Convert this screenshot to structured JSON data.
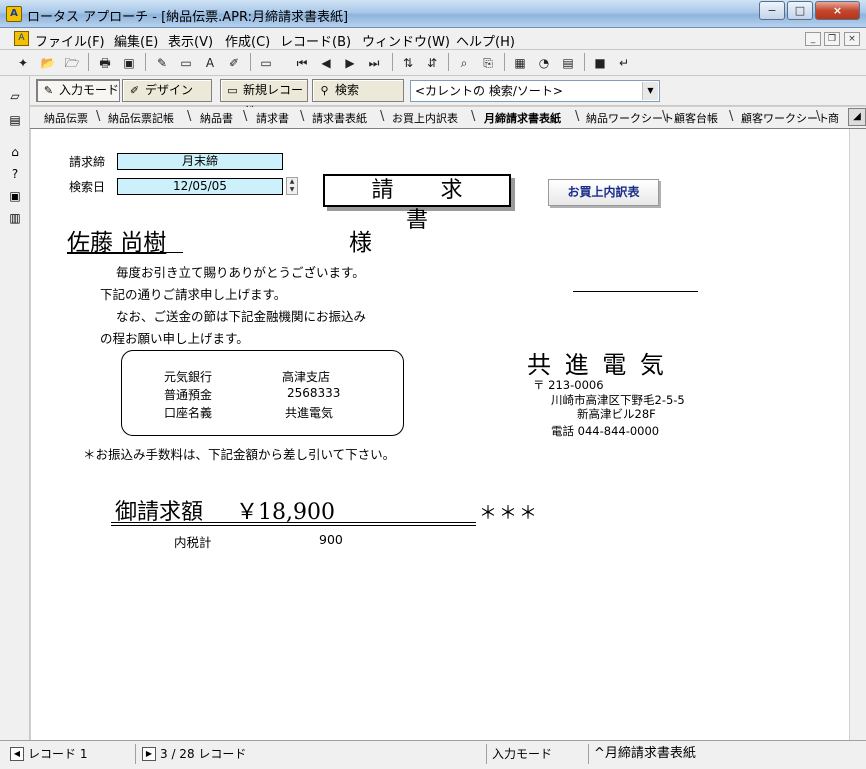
{
  "window": {
    "title": "ロータス アプローチ - [納品伝票.APR:月締請求書表紙]",
    "minimize": "−",
    "maximize": "□",
    "close": "×"
  },
  "menu": [
    "ファイル(F)",
    "編集(E)",
    "表示(V)",
    "作成(C)",
    "レコード(B)",
    "ウィンドウ(W)",
    "ヘルプ(H)"
  ],
  "toolbar2": {
    "input_mode": "入力モード",
    "design": "デザイン",
    "new_record": "新規レコード",
    "search": "検索",
    "search_select": "<カレントの 検索/ソート>"
  },
  "tabs": [
    "納品伝票",
    "納品伝票記帳",
    "納品書",
    "請求書",
    "請求書表紙",
    "お買上内訳表",
    "月締請求書表紙",
    "納品ワークシート",
    "顧客台帳",
    "顧客ワークシート",
    "商"
  ],
  "active_tab": 6,
  "form": {
    "closing_label": "請求締",
    "closing_value": "月末締",
    "search_date_label": "検索日",
    "search_date_value": "12/05/05",
    "doc_title": "請 求 書",
    "breakdown_button": "お買上内訳表",
    "customer_name": "佐藤 尚樹",
    "honorific": "様",
    "greeting": [
      "毎度お引き立て賜りありがとうございます。",
      "下記の通りご請求申し上げます。",
      "なお、ご送金の節は下記金融機関にお振込み",
      "の程お願い申し上げます。"
    ],
    "bank": {
      "bank_name": "元気銀行",
      "branch": "高津支店",
      "account_type": "普通預金",
      "account_no": "2568333",
      "holder_label": "口座名義",
      "holder": "共進電気"
    },
    "fee_note": "＊お振込み手数料は、下記金額から差し引いて下さい。",
    "company": {
      "name": "共 進 電 気",
      "postal": "〒 213-0006",
      "address1": "川崎市高津区下野毛2-5-5",
      "address2": "新高津ビル28F",
      "phone": "電話 044-844-0000"
    },
    "amount_label": "御請求額",
    "amount_value": "￥18,900",
    "amount_suffix": "＊＊＊",
    "tax_label": "内税計",
    "tax_value": "900"
  },
  "status": {
    "record_label": "レコード 1",
    "record_count": "3 / 28 レコード",
    "mode": "入力モード",
    "view": "^月締請求書表紙"
  }
}
